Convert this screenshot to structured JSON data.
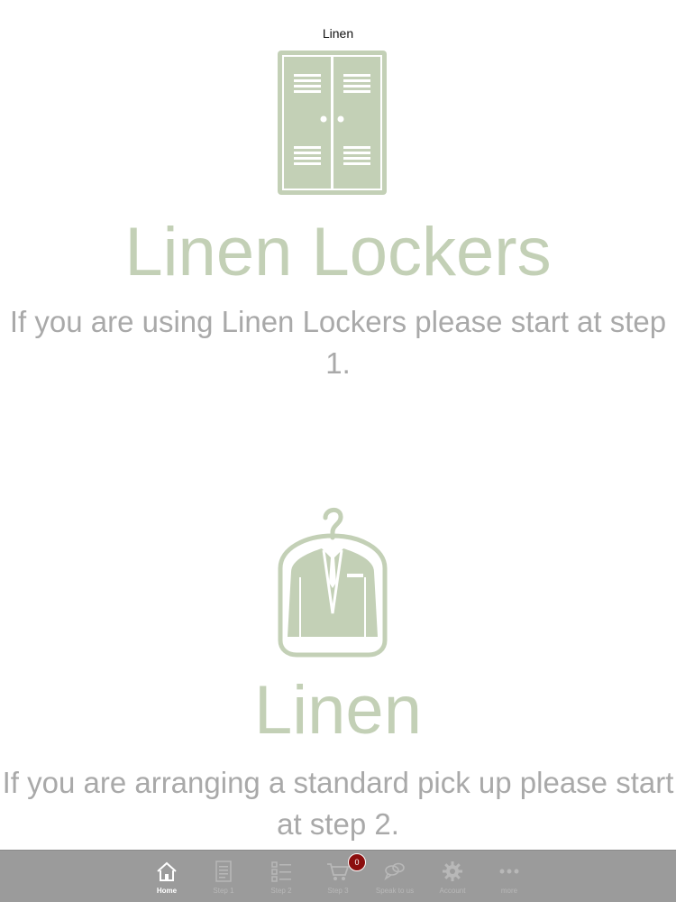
{
  "nav": {
    "title": "Linen"
  },
  "lockers_section": {
    "icon": "locker-icon",
    "heading": "Linen Lockers",
    "description": "If you are using Linen Lockers please start at step 1."
  },
  "linen_section": {
    "icon": "suit-bag-icon",
    "heading": "Linen",
    "description": "If you are arranging a standard pick up please start at step 2."
  },
  "tab_bar": {
    "tabs": [
      {
        "label": "Home",
        "icon": "home-icon",
        "active": true
      },
      {
        "label": "Step 1",
        "icon": "document-icon",
        "active": false
      },
      {
        "label": "Step 2",
        "icon": "checklist-icon",
        "active": false
      },
      {
        "label": "Step 3",
        "icon": "cart-icon",
        "active": false
      },
      {
        "label": "Speak to us",
        "icon": "chat-icon",
        "active": false
      },
      {
        "label": "Account",
        "icon": "gear-icon",
        "active": false
      },
      {
        "label": "more",
        "icon": "more-icon",
        "active": false
      }
    ],
    "cart_badge": "0"
  },
  "colors": {
    "icon_green": "#c3d0b6",
    "text_gray": "#a9a9a9",
    "tab_bar_bg": "#9b9b9b",
    "badge_red": "#8b0e0e"
  }
}
